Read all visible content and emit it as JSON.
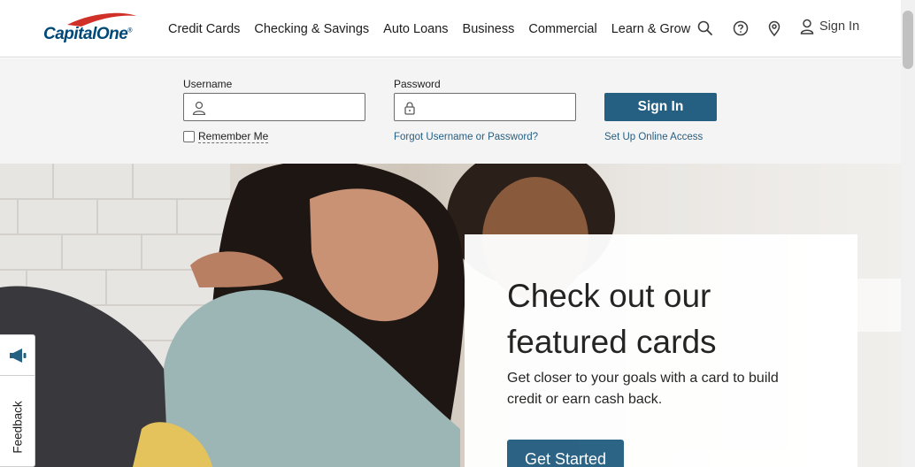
{
  "brand": {
    "logo_text": "Capital",
    "logo_text_2": "One",
    "logo_mark": "®",
    "brand_color": "#004878",
    "swoosh_color": "#d03027"
  },
  "nav": {
    "items": [
      {
        "label": "Credit Cards"
      },
      {
        "label": "Checking & Savings"
      },
      {
        "label": "Auto Loans"
      },
      {
        "label": "Business"
      },
      {
        "label": "Commercial"
      },
      {
        "label": "Learn & Grow"
      }
    ],
    "icons": [
      "search-icon",
      "help-icon",
      "location-icon",
      "user-icon"
    ],
    "signin_label": "Sign In"
  },
  "login": {
    "username_label": "Username",
    "username_value": "",
    "password_label": "Password",
    "password_value": "",
    "remember_label": "Remember Me",
    "remember_checked": false,
    "forgot_label": "Forgot Username or Password?",
    "signin_button": "Sign In",
    "setup_label": "Set Up Online Access",
    "button_color": "#255f82"
  },
  "hero": {
    "title": "Check out our featured cards",
    "description": "Get closer to your goals with a card to build credit or earn cash back.",
    "cta": "Get Started"
  },
  "feedback": {
    "label": "Feedback",
    "icon": "megaphone-icon"
  }
}
